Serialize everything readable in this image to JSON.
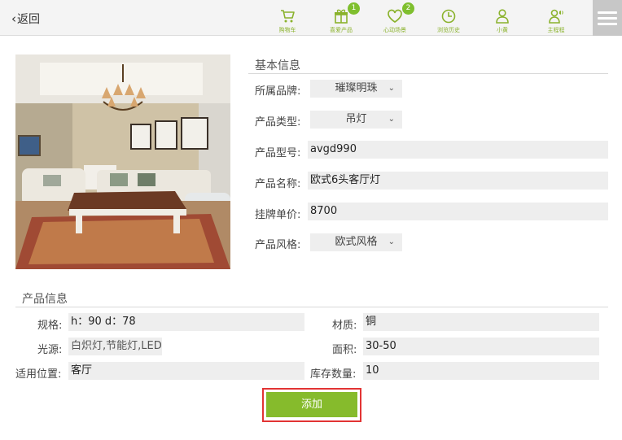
{
  "header": {
    "back_label": "返回",
    "tabs": [
      {
        "label": "购物车",
        "icon": "cart-icon",
        "badge": ""
      },
      {
        "label": "喜爱产品",
        "icon": "gift-icon",
        "badge": "1"
      },
      {
        "label": "心动场景",
        "icon": "heart-icon",
        "badge": "2"
      },
      {
        "label": "浏览历史",
        "icon": "clock-icon",
        "badge": ""
      },
      {
        "label": "小黄",
        "icon": "user-icon",
        "badge": ""
      },
      {
        "label": "主程程",
        "icon": "user-speaker-icon",
        "badge": ""
      }
    ],
    "accent_color": "#86bb2c"
  },
  "basic_info": {
    "title": "基本信息",
    "brand_label": "所属品牌:",
    "brand_value": "璀璨明珠",
    "type_label": "产品类型:",
    "type_value": "吊灯",
    "model_label": "产品型号:",
    "model_value": "avgd990",
    "name_label": "产品名称:",
    "name_value": "欧式6头客厅灯",
    "price_label": "挂牌单价:",
    "price_value": "8700",
    "style_label": "产品风格:",
    "style_value": "欧式风格"
  },
  "product_info": {
    "title": "产品信息",
    "spec_label": "规格:",
    "spec_value": "h：90 d：78",
    "material_label": "材质:",
    "material_value": "铜",
    "light_label": "光源:",
    "light_value": "白炽灯,节能灯,LED",
    "area_label": "面积:",
    "area_value": "30-50",
    "location_label": "适用位置:",
    "location_value": "客厅",
    "stock_label": "库存数量:",
    "stock_value": "10"
  },
  "actions": {
    "add_label": "添加",
    "highlight_color": "#e23434"
  }
}
